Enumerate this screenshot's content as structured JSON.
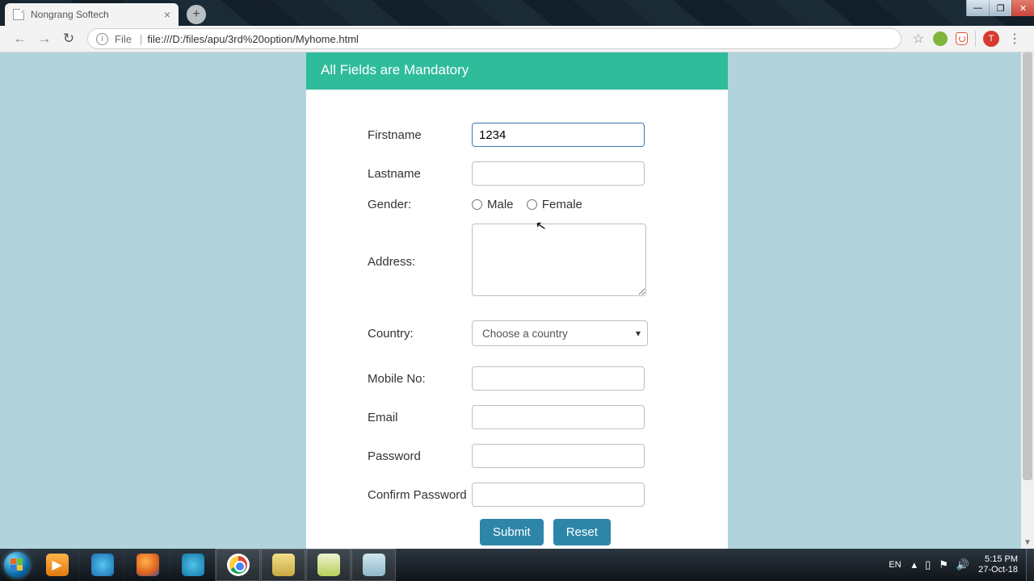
{
  "browser": {
    "tab_title": "Nongrang Softech",
    "address_prefix": "File",
    "url": "file:///D:/files/apu/3rd%20option/Myhome.html"
  },
  "form": {
    "header": "All Fields are Mandatory",
    "labels": {
      "firstname": "Firstname",
      "lastname": "Lastname",
      "gender": "Gender:",
      "address": "Address:",
      "country": "Country:",
      "mobile": "Mobile No:",
      "email": "Email",
      "password": "Password",
      "confirm": "Confirm Password"
    },
    "values": {
      "firstname": "1234",
      "lastname": "",
      "address": "",
      "mobile": "",
      "email": "",
      "password": "",
      "confirm": ""
    },
    "gender_options": {
      "male": "Male",
      "female": "Female"
    },
    "country_placeholder": "Choose a country",
    "buttons": {
      "submit": "Submit",
      "reset": "Reset"
    }
  },
  "taskbar": {
    "lang": "EN",
    "time": "5:15 PM",
    "date": "27-Oct-18"
  }
}
